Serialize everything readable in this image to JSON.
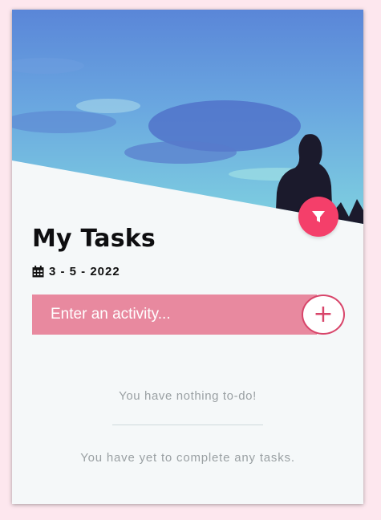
{
  "colors": {
    "accent": "#f43f6a",
    "input_bg": "#e8899f",
    "add_border": "#d8456a",
    "card_bg": "#f5f8f9",
    "page_bg": "#fde7ee",
    "muted_text": "#9aa0a3"
  },
  "header": {
    "image": "sky-person-photo",
    "filter_icon": "filter-icon"
  },
  "main": {
    "title": "My Tasks",
    "date_icon": "calendar-icon",
    "date": "3 - 5 - 2022"
  },
  "input": {
    "placeholder": "Enter an activity...",
    "value": "",
    "add_label": "+"
  },
  "todo": {
    "empty_message": "You have nothing to-do!"
  },
  "completed": {
    "empty_message": "You have yet to complete any tasks."
  }
}
